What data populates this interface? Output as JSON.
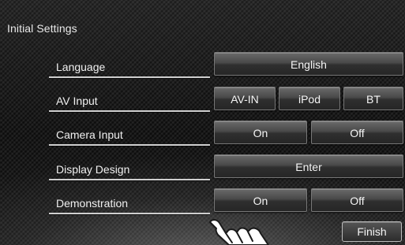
{
  "screen": {
    "title": "Initial Settings"
  },
  "rows": [
    {
      "label": "Language",
      "options": [
        "English"
      ]
    },
    {
      "label": "AV Input",
      "options": [
        "AV-IN",
        "iPod",
        "BT"
      ]
    },
    {
      "label": "Camera Input",
      "options": [
        "On",
        "Off"
      ]
    },
    {
      "label": "Display Design",
      "options": [
        "Enter"
      ]
    },
    {
      "label": "Demonstration",
      "options": [
        "On",
        "Off"
      ]
    }
  ],
  "footer": {
    "finish_label": "Finish"
  },
  "icons": {
    "pointer": "hand-pointer-icon"
  }
}
